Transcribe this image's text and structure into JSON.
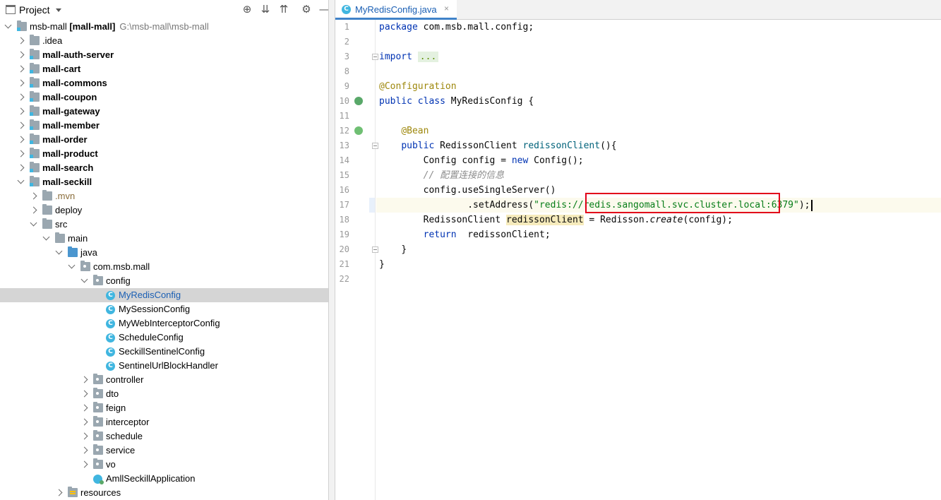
{
  "project_panel": {
    "title": "Project",
    "tree": [
      {
        "label": "msb-mall",
        "bold_suffix": "[mall-mall]",
        "path": "G:\\msb-mall\\msb-mall",
        "depth": 0,
        "expanded": true,
        "icon": "module-folder-icon"
      },
      {
        "label": ".idea",
        "depth": 1,
        "expanded": false,
        "icon": "folder-icon"
      },
      {
        "label": "mall-auth-server",
        "depth": 1,
        "expanded": false,
        "icon": "module-folder-icon",
        "bold": true
      },
      {
        "label": "mall-cart",
        "depth": 1,
        "expanded": false,
        "icon": "module-folder-icon",
        "bold": true
      },
      {
        "label": "mall-commons",
        "depth": 1,
        "expanded": false,
        "icon": "module-folder-icon",
        "bold": true
      },
      {
        "label": "mall-coupon",
        "depth": 1,
        "expanded": false,
        "icon": "module-folder-icon",
        "bold": true
      },
      {
        "label": "mall-gateway",
        "depth": 1,
        "expanded": false,
        "icon": "module-folder-icon",
        "bold": true
      },
      {
        "label": "mall-member",
        "depth": 1,
        "expanded": false,
        "icon": "module-folder-icon",
        "bold": true
      },
      {
        "label": "mall-order",
        "depth": 1,
        "expanded": false,
        "icon": "module-folder-icon",
        "bold": true
      },
      {
        "label": "mall-product",
        "depth": 1,
        "expanded": false,
        "icon": "module-folder-icon",
        "bold": true
      },
      {
        "label": "mall-search",
        "depth": 1,
        "expanded": false,
        "icon": "module-folder-icon",
        "bold": true
      },
      {
        "label": "mall-seckill",
        "depth": 1,
        "expanded": true,
        "icon": "module-folder-icon",
        "bold": true
      },
      {
        "label": ".mvn",
        "depth": 2,
        "expanded": false,
        "icon": "folder-icon"
      },
      {
        "label": "deploy",
        "depth": 2,
        "expanded": false,
        "icon": "folder-icon"
      },
      {
        "label": "src",
        "depth": 2,
        "expanded": true,
        "icon": "folder-icon"
      },
      {
        "label": "main",
        "depth": 3,
        "expanded": true,
        "icon": "folder-icon"
      },
      {
        "label": "java",
        "depth": 4,
        "expanded": true,
        "icon": "source-folder-icon"
      },
      {
        "label": "com.msb.mall",
        "depth": 5,
        "expanded": true,
        "icon": "package-icon"
      },
      {
        "label": "config",
        "depth": 6,
        "expanded": true,
        "icon": "package-icon"
      },
      {
        "label": "MyRedisConfig",
        "depth": 7,
        "icon": "java-class-icon",
        "selected": true
      },
      {
        "label": "MySessionConfig",
        "depth": 7,
        "icon": "java-class-icon"
      },
      {
        "label": "MyWebInterceptorConfig",
        "depth": 7,
        "icon": "java-class-icon"
      },
      {
        "label": "ScheduleConfig",
        "depth": 7,
        "icon": "java-class-icon"
      },
      {
        "label": "SeckillSentinelConfig",
        "depth": 7,
        "icon": "java-class-icon"
      },
      {
        "label": "SentinelUrlBlockHandler",
        "depth": 7,
        "icon": "java-class-icon"
      },
      {
        "label": "controller",
        "depth": 6,
        "expanded": false,
        "icon": "package-icon"
      },
      {
        "label": "dto",
        "depth": 6,
        "expanded": false,
        "icon": "package-icon"
      },
      {
        "label": "feign",
        "depth": 6,
        "expanded": false,
        "icon": "package-icon"
      },
      {
        "label": "interceptor",
        "depth": 6,
        "expanded": false,
        "icon": "package-icon"
      },
      {
        "label": "schedule",
        "depth": 6,
        "expanded": false,
        "icon": "package-icon"
      },
      {
        "label": "service",
        "depth": 6,
        "expanded": false,
        "icon": "package-icon"
      },
      {
        "label": "vo",
        "depth": 6,
        "expanded": false,
        "icon": "package-icon"
      },
      {
        "label": "AmllSeckillApplication",
        "depth": 6,
        "icon": "spring-boot-app-icon"
      },
      {
        "label": "resources",
        "depth": 4,
        "expanded": false,
        "icon": "resources-folder-icon"
      }
    ]
  },
  "editor": {
    "tab": {
      "label": "MyRedisConfig.java",
      "close_glyph": "×",
      "icon_letter": "C"
    },
    "line_numbers": [
      "1",
      "2",
      "3",
      "8",
      "9",
      "10",
      "11",
      "12",
      "13",
      "14",
      "15",
      "16",
      "17",
      "18",
      "19",
      "20",
      "21",
      "22"
    ],
    "code": {
      "l1": {
        "kw": "package",
        "rest": " com.msb.mall.config;"
      },
      "l3": {
        "kw": "import",
        "dots": "..."
      },
      "l9": {
        "ann": "@Configuration"
      },
      "l10": {
        "kw1": "public",
        "kw2": "class",
        "rest": " MyRedisConfig {"
      },
      "l12": {
        "ann": "@Bean"
      },
      "l13": {
        "kw": "public",
        "type": " RedissonClient ",
        "method": "redissonClient",
        "rest": "(){"
      },
      "l14": {
        "pre": "Config config = ",
        "kw": "new",
        "rest": " Config();"
      },
      "l15": {
        "comment": "// 配置连接的信息"
      },
      "l16": {
        "text": "config.useSingleServer()"
      },
      "l17": {
        "pre": ".setAddress(",
        "str": "\"redis://redis.sangomall.svc.cluster.local:6379\"",
        "rest": ");"
      },
      "l18": {
        "pre": "RedissonClient ",
        "var": "redissonClient",
        "mid": " = Redisson.",
        "call": "create",
        "rest": "(config);"
      },
      "l19": {
        "kw": "return",
        "rest": "  redissonClient;"
      },
      "l20": {
        "text": "}"
      },
      "l21": {
        "text": "}"
      }
    }
  },
  "colors": {
    "keyword": "#0033b3",
    "annotation": "#9e880d",
    "string": "#067d17",
    "comment": "#8c8c8c",
    "highlight_box": "#e2001a",
    "selection": "#d5d5d5"
  }
}
